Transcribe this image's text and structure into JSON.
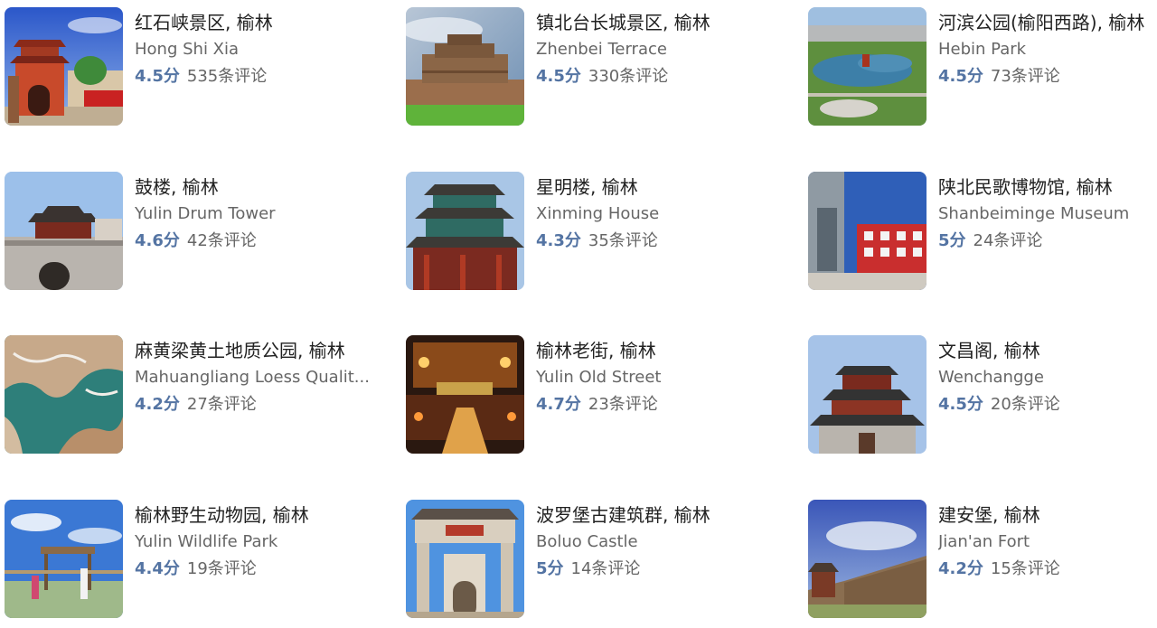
{
  "attractions": [
    {
      "name": "红石峡景区, 榆林",
      "english": "Hong Shi Xia",
      "score": "4.5分",
      "reviews": "535条评论",
      "image": "red-temple-photo"
    },
    {
      "name": "镇北台长城景区, 榆林",
      "english": "Zhenbei Terrace",
      "score": "4.5分",
      "reviews": "330条评论",
      "image": "great-wall-fort-photo"
    },
    {
      "name": "河滨公园(榆阳西路), 榆林",
      "english": "Hebin Park",
      "score": "4.5分",
      "reviews": "73条评论",
      "image": "river-park-aerial-photo"
    },
    {
      "name": "鼓楼, 榆林",
      "english": "Yulin Drum Tower",
      "score": "4.6分",
      "reviews": "42条评论",
      "image": "drum-tower-photo"
    },
    {
      "name": "星明楼, 榆林",
      "english": "Xinming House",
      "score": "4.3分",
      "reviews": "35条评论",
      "image": "pavilion-photo"
    },
    {
      "name": "陕北民歌博物馆, 榆林",
      "english": "Shanbeiminge Museum",
      "score": "5分",
      "reviews": "24条评论",
      "image": "museum-building-photo"
    },
    {
      "name": "麻黄梁黄土地质公园, 榆林",
      "english": "Mahuangliang Loess Qualit...",
      "score": "4.2分",
      "reviews": "27条评论",
      "image": "loess-aerial-photo"
    },
    {
      "name": "榆林老街, 榆林",
      "english": "Yulin Old Street",
      "score": "4.7分",
      "reviews": "23条评论",
      "image": "old-street-night-photo"
    },
    {
      "name": "文昌阁, 榆林",
      "english": "Wenchangge",
      "score": "4.5分",
      "reviews": "20条评论",
      "image": "pagoda-photo"
    },
    {
      "name": "榆林野生动物园, 榆林",
      "english": "Yulin Wildlife Park",
      "score": "4.4分",
      "reviews": "19条评论",
      "image": "wildlife-park-photo"
    },
    {
      "name": "波罗堡古建筑群, 榆林",
      "english": "Boluo Castle",
      "score": "5分",
      "reviews": "14条评论",
      "image": "stone-archway-photo"
    },
    {
      "name": "建安堡, 榆林",
      "english": "Jian'an Fort",
      "score": "4.2分",
      "reviews": "15条评论",
      "image": "fort-wall-photo"
    }
  ],
  "colors": {
    "score": "#5474a3",
    "title": "#222222",
    "secondary": "#666666"
  }
}
